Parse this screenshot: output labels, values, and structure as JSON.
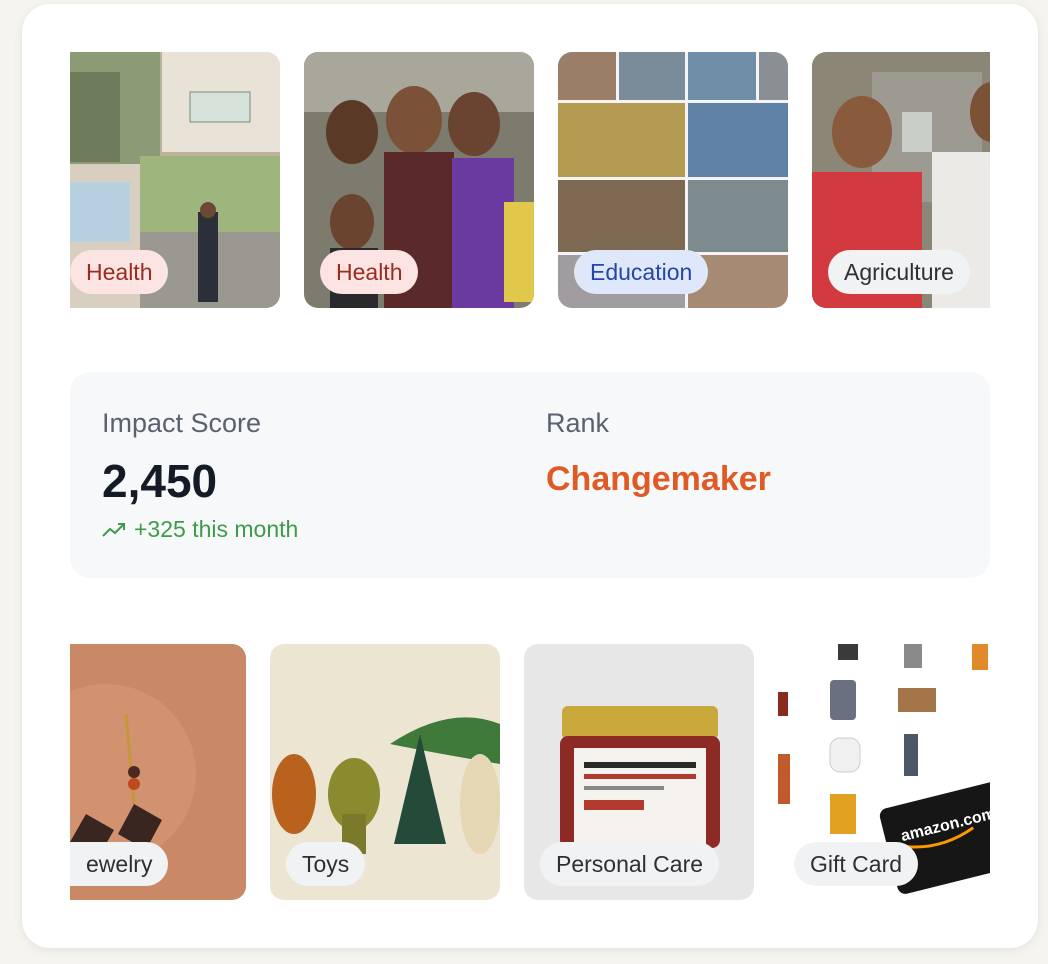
{
  "causes": [
    {
      "tag": "Health",
      "tone": "health"
    },
    {
      "tag": "Health",
      "tone": "health"
    },
    {
      "tag": "Education",
      "tone": "education"
    },
    {
      "tag": "Agriculture",
      "tone": "neutral"
    }
  ],
  "impact": {
    "score_label": "Impact Score",
    "score_value": "2,450",
    "trend_text": "+325 this month",
    "trend_icon": "trending-up-icon",
    "rank_label": "Rank",
    "rank_value": "Changemaker"
  },
  "products": [
    {
      "tag": "ewelry"
    },
    {
      "tag": "Toys"
    },
    {
      "tag": "Personal Care"
    },
    {
      "tag": "Gift Card"
    }
  ],
  "colors": {
    "rank_accent": "#e05a26",
    "trend_green": "#3f9a4a"
  }
}
